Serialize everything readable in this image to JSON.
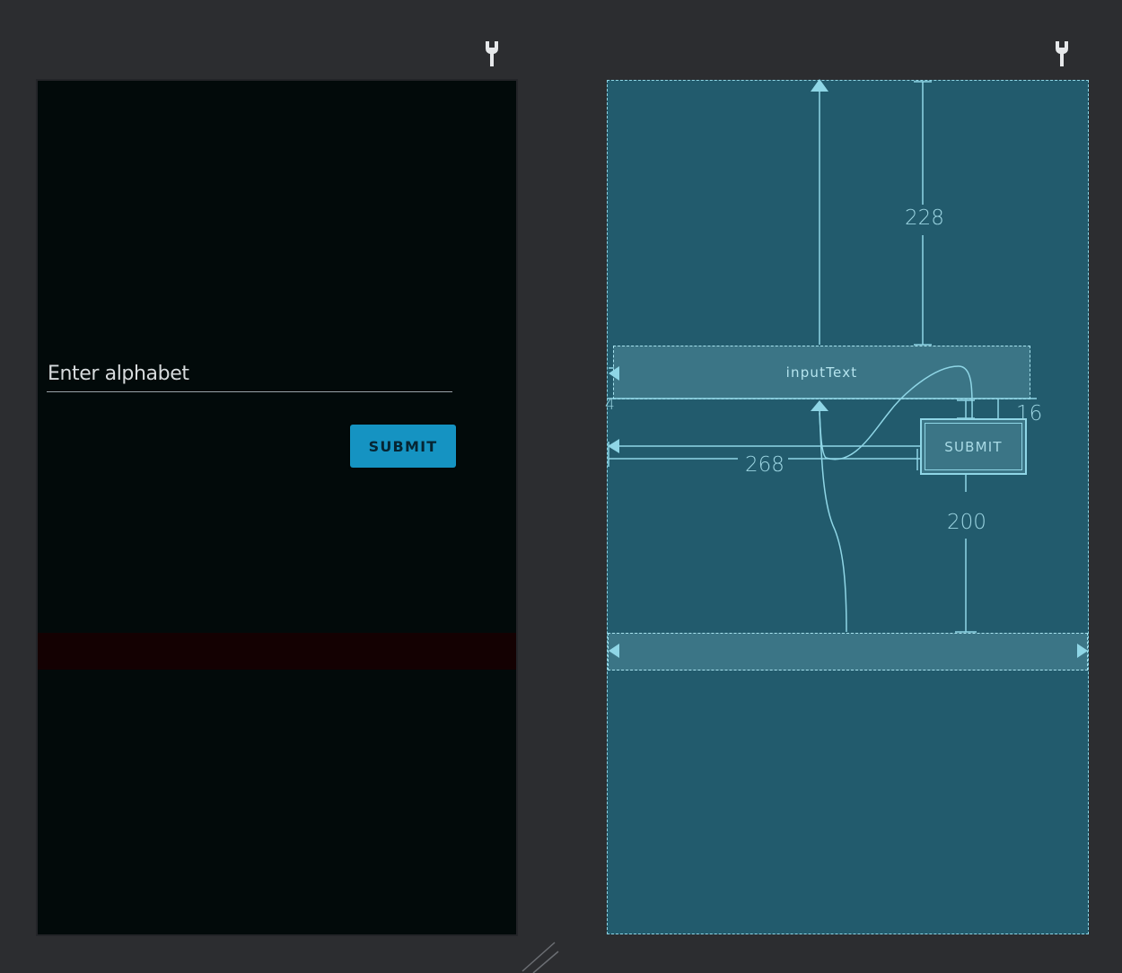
{
  "design_view": {
    "edit_text_hint": "Enter alphabet",
    "submit_label": "SUBMIT"
  },
  "blueprint_view": {
    "input_id": "inputText",
    "submit_label": "SUBMIT",
    "margins": {
      "input_top": "228",
      "input_left": "4",
      "button_top": "16",
      "button_left": "268",
      "button_bottom": "200"
    }
  },
  "icons": {
    "design_wrench": "wrench-icon",
    "blueprint_wrench": "wrench-icon",
    "resize_handle": "resize-handle-icon"
  },
  "colors": {
    "background": "#2c2d30",
    "design_screen": "#020a0a",
    "button_accent": "#1593c2",
    "blueprint_bg": "#225b6d",
    "blueprint_line": "#8fd6e6"
  }
}
